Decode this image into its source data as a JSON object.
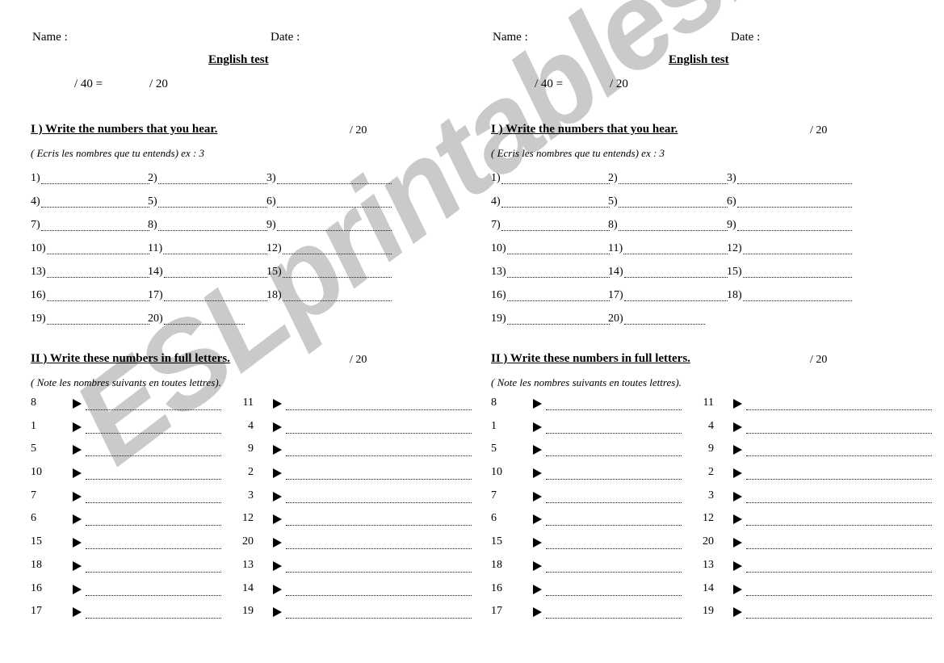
{
  "document": {
    "title": "English test",
    "watermark": "ESLprintables.com",
    "watermark_color": "#c8c8c8",
    "copies": 2
  },
  "header": {
    "name_label": "Name :",
    "date_label": "Date :",
    "title": "English test",
    "score_total": "/ 40 =",
    "score_converted": "/ 20"
  },
  "section1": {
    "title": "I ) Write the numbers that you hear.",
    "points": "/ 20",
    "subtitle": "( Ecris les nombres que tu entends) ex : 3",
    "rows": [
      [
        "1)",
        "2)",
        "3)"
      ],
      [
        "4)",
        "5)",
        "6)"
      ],
      [
        "7)",
        "8)",
        "9)"
      ],
      [
        "10)",
        "11)",
        "12)"
      ],
      [
        "13)",
        "14)",
        "15)"
      ],
      [
        "16)",
        "17)",
        "18)"
      ],
      [
        "19)",
        "20)",
        ""
      ]
    ]
  },
  "section2": {
    "title": "II ) Write these numbers in full letters.",
    "points": "/ 20",
    "subtitle": "( Note les nombres suivants en toutes lettres).",
    "arrow_icon": "triangle-right-icon",
    "rows": [
      [
        "8",
        "11"
      ],
      [
        "1",
        "4"
      ],
      [
        "5",
        "9"
      ],
      [
        "10",
        "2"
      ],
      [
        "7",
        "3"
      ],
      [
        "6",
        "12"
      ],
      [
        "15",
        "20"
      ],
      [
        "18",
        "13"
      ],
      [
        "16",
        "14"
      ],
      [
        "17",
        "19"
      ]
    ]
  }
}
